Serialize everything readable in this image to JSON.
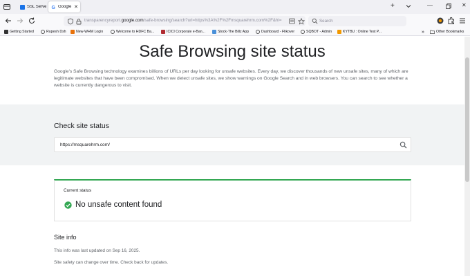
{
  "browser": {
    "tabs": [
      {
        "label": "SSL Serve",
        "favicon_color": "#1a73e8"
      },
      {
        "label": "Google",
        "favicon_color": "#4285f4"
      }
    ],
    "address_bar": {
      "url_prefix": "transparencyreport.",
      "url_domain": "google.com",
      "url_rest": "/safe-browsing/search?url=https%3A%2F%2Fmsquarehrm.com%2F&hl="
    },
    "search_bar": {
      "placeholder": "Search"
    },
    "bookmarks": [
      {
        "label": "Getting Started",
        "icon_color": "#333333"
      },
      {
        "label": "Rupesh Dsh",
        "icon_color": "#555555"
      },
      {
        "label": "New-WHM Login",
        "icon_color": "#e8710a"
      },
      {
        "label": "Welcome to HDFC Ba...",
        "icon_color": "#555555"
      },
      {
        "label": "ICICI Corporate e-Ban...",
        "icon_color": "#b02a30"
      },
      {
        "label": "Stock-The Billz App",
        "icon_color": "#4a90d9"
      },
      {
        "label": "Dashboard - Flikover",
        "icon_color": "#555555"
      },
      {
        "label": "SQBOT - Admin",
        "icon_color": "#555555"
      },
      {
        "label": "KYTBU : Online Test P...",
        "icon_color": "#f29900"
      }
    ],
    "other_bookmarks": "Other Bookmarks"
  },
  "page": {
    "title": "Safe Browsing site status",
    "intro": "Google's Safe Browsing technology examines billions of URLs per day looking for unsafe websites. Every day, we discover thousands of new unsafe sites, many of which are legitimate websites that have been compromised. When we detect unsafe sites, we show warnings on Google Search and in web browsers. You can search to see whether a website is currently dangerous to visit.",
    "check_section": {
      "title": "Check site status",
      "search_value": "https://msquarehrm.com/"
    },
    "status_card": {
      "label": "Current status",
      "status_text": "No unsafe content found",
      "status_color": "#34a853"
    },
    "site_info": {
      "title": "Site info",
      "line1": "This info was last updated on Sep 16, 2025.",
      "line2": "Site safety can change over time. Check back for updates."
    }
  }
}
